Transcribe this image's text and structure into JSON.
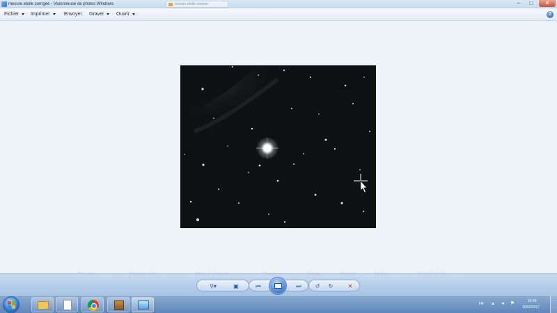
{
  "window": {
    "title": "mesure etoile corrigée - Visionneuse de photos Windows",
    "background_tab_title": "mesure etoile mesure",
    "buttons": {
      "minimize": "–",
      "maximize": "□",
      "close": "✕"
    }
  },
  "menu": {
    "items": [
      "Fichier",
      "Imprimer",
      "Envoyer",
      "Graver",
      "Ouvrir"
    ],
    "help": "?"
  },
  "viewer": {
    "image": {
      "description_icon": "star-field-photo",
      "background_color": "#0f1012",
      "bright_star_color": "#ffffff"
    }
  },
  "controls": {
    "faded_labels": [
      "Plein écran",
      "Diaporama rapide",
      "Options de diaporama",
      "Réduire",
      "Agrandir",
      "Supprimer",
      "Rotation",
      "Ajuster à la fenêtre"
    ],
    "zoom": "⚲▾",
    "actual_size": "▣",
    "previous": "⏮",
    "next": "⏭",
    "rotate_left": "↺",
    "rotate_right": "↻",
    "delete": "✕"
  },
  "taskbar": {
    "tray": {
      "language": "FR",
      "time": "16:49",
      "date": "10/02/2017"
    }
  }
}
